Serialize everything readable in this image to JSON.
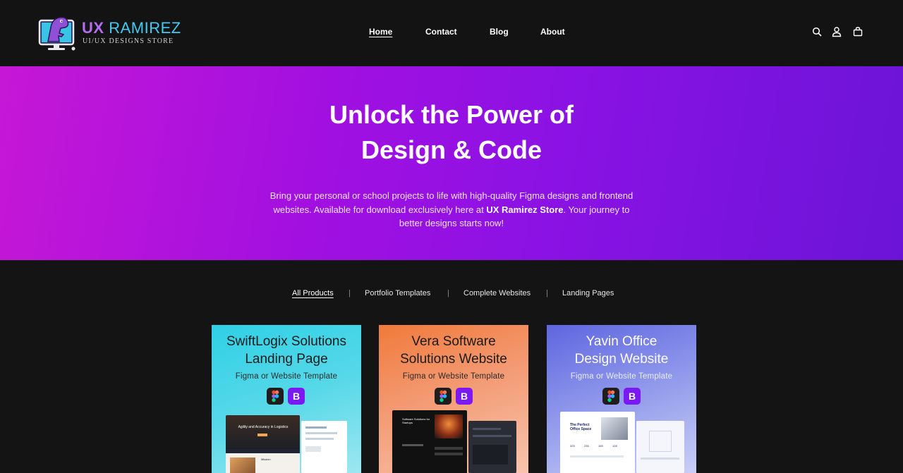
{
  "header": {
    "logo_title_a": "UX",
    "logo_title_b": "RAMIREZ",
    "logo_sub": "UI/UX DESIGNS STORE",
    "nav": [
      "Home",
      "Contact",
      "Blog",
      "About"
    ],
    "icons": [
      "search-icon",
      "user-icon",
      "cart-icon"
    ]
  },
  "hero": {
    "title_line1": "Unlock the Power of",
    "title_line2": "Design & Code",
    "desc_pre": "Bring your personal or school projects to life with high-quality Figma designs and frontend websites. Available for download exclusively here at ",
    "desc_strong": "UX Ramirez Store",
    "desc_post": ". Your journey to better designs starts now!"
  },
  "filters": {
    "items": [
      "All Products",
      "Portfolio Templates",
      "Complete Websites",
      "Landing Pages"
    ],
    "active": "All Products",
    "separator": "|"
  },
  "products": [
    {
      "title_line1": "SwiftLogix Solutions",
      "title_line2": "Landing Page",
      "subtitle": "Figma or Website Template",
      "badge_b": "B",
      "preview_heading": "Agility and Accuracy in Logistics",
      "preview_section": "Mission"
    },
    {
      "title_line1": "Vera Software",
      "title_line2": "Solutions Website",
      "subtitle": "Figma or Website Template",
      "badge_b": "B",
      "preview_heading": "Software Solutions for Startups"
    },
    {
      "title_line1": "Yavin Office",
      "title_line2": "Design Website",
      "subtitle": "Figma or Website Template",
      "badge_b": "B",
      "preview_heading": "The Perfect Office Space",
      "preview_stats": [
        "325",
        "235",
        "155",
        "128"
      ]
    }
  ],
  "colors": {
    "header_bg": "#131313",
    "page_bg": "#141414",
    "hero_start": "#c617d6",
    "hero_end": "#6b14d8",
    "brand_purple": "#b46cf0",
    "brand_cyan": "#46c9f0",
    "bootstrap": "#7a19f2"
  }
}
